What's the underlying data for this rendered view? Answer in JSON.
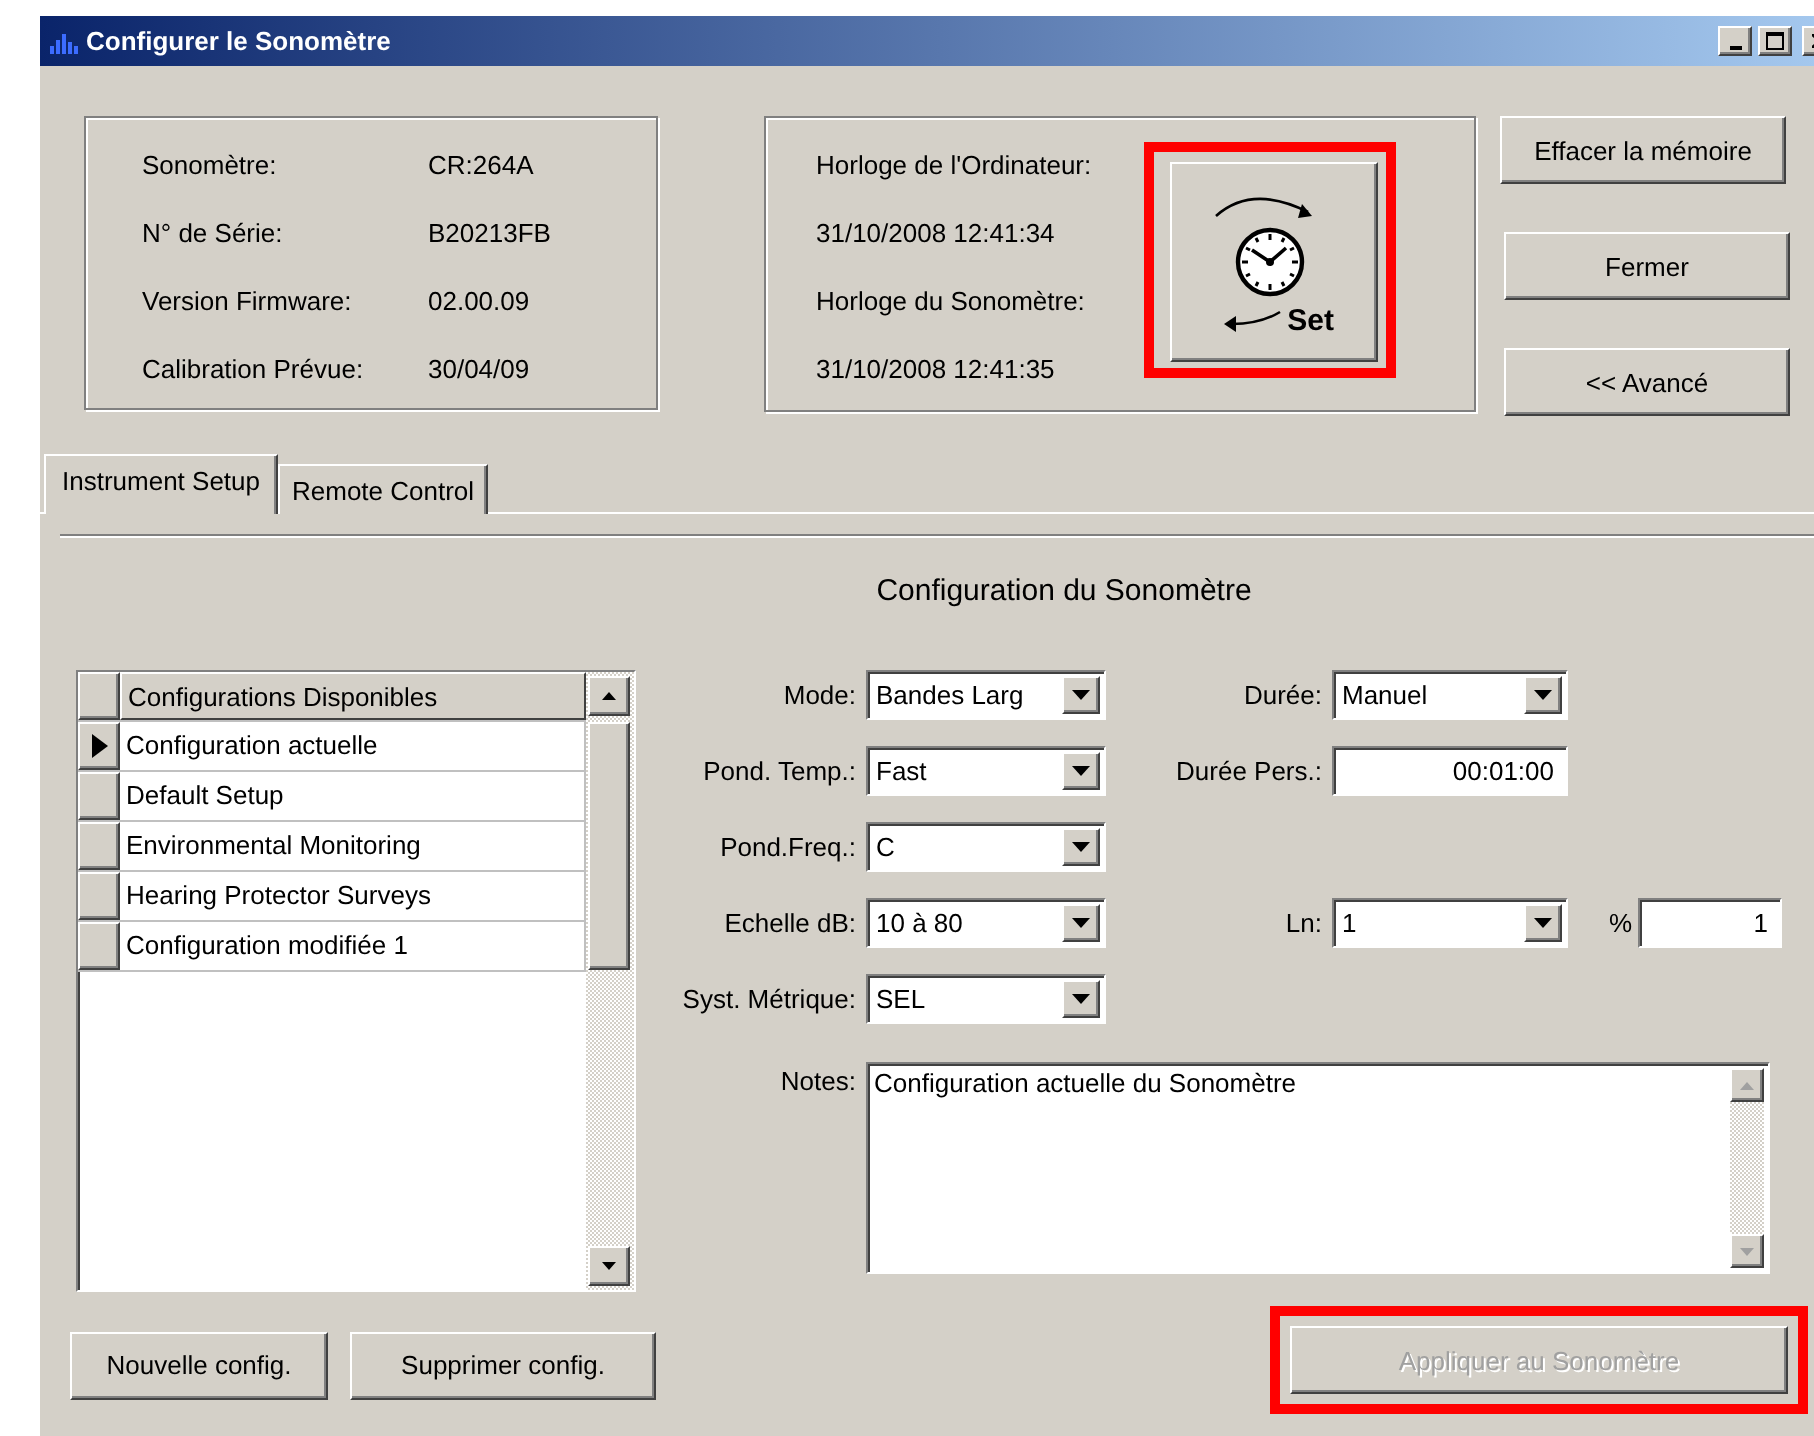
{
  "window": {
    "title": "Configurer le Sonomètre"
  },
  "meter_info": [
    {
      "label": "Sonomètre:",
      "value": "CR:264A"
    },
    {
      "label": "N° de Série:",
      "value": "B20213FB"
    },
    {
      "label": "Version Firmware:",
      "value": "02.00.09"
    },
    {
      "label": "Calibration Prévue:",
      "value": "30/04/09"
    }
  ],
  "clocks": {
    "lines": [
      "Horloge de l'Ordinateur:",
      "31/10/2008 12:41:34",
      "Horloge du Sonomètre:",
      "31/10/2008 12:41:35"
    ],
    "set_button": {
      "label": "Set",
      "highlighted": true
    }
  },
  "side_buttons": [
    "Effacer la mémoire",
    "Fermer",
    "<< Avancé"
  ],
  "tabs": [
    {
      "label": "Instrument Setup",
      "selected": true
    },
    {
      "label": "Remote Control",
      "selected": false
    }
  ],
  "heading": "Configuration du Sonomètre",
  "config_list": {
    "header": "Configurations Disponibles",
    "rows": [
      {
        "name": "Configuration actuelle",
        "selected": true
      },
      {
        "name": "Default Setup",
        "selected": false
      },
      {
        "name": "Environmental Monitoring",
        "selected": false
      },
      {
        "name": "Hearing Protector Surveys",
        "selected": false
      },
      {
        "name": "Configuration modifiée 1",
        "selected": false
      }
    ]
  },
  "form_rows": [
    {
      "left": {
        "label": "Mode:",
        "value": "Bandes Larg",
        "kind": "combo"
      },
      "right": [
        {
          "label": "Durée:",
          "value": "Manuel",
          "kind": "combo"
        }
      ]
    },
    {
      "left": {
        "label": "Pond. Temp.:",
        "value": "Fast",
        "kind": "combo"
      },
      "right": [
        {
          "label": "Durée Pers.:",
          "value": "00:01:00",
          "kind": "text"
        }
      ]
    },
    {
      "left": {
        "label": "Pond.Freq.:",
        "value": "C",
        "kind": "combo"
      }
    },
    {
      "left": {
        "label": "Echelle dB:",
        "value": "10 à 80",
        "kind": "combo"
      },
      "right": [
        {
          "label": "Ln:",
          "value": "1",
          "kind": "combo"
        },
        {
          "label": "%",
          "value": "1",
          "kind": "short"
        }
      ]
    },
    {
      "left": {
        "label": "Syst. Métrique:",
        "value": "SEL",
        "kind": "combo"
      }
    }
  ],
  "notes": {
    "label": "Notes:",
    "value": "Configuration actuelle du Sonomètre"
  },
  "bottom_buttons": [
    {
      "label": "Nouvelle config.",
      "disabled": false
    },
    {
      "label": "Supprimer config.",
      "disabled": false
    }
  ],
  "apply_button": {
    "label": "Appliquer au Sonomètre",
    "disabled": true,
    "highlighted": true
  }
}
